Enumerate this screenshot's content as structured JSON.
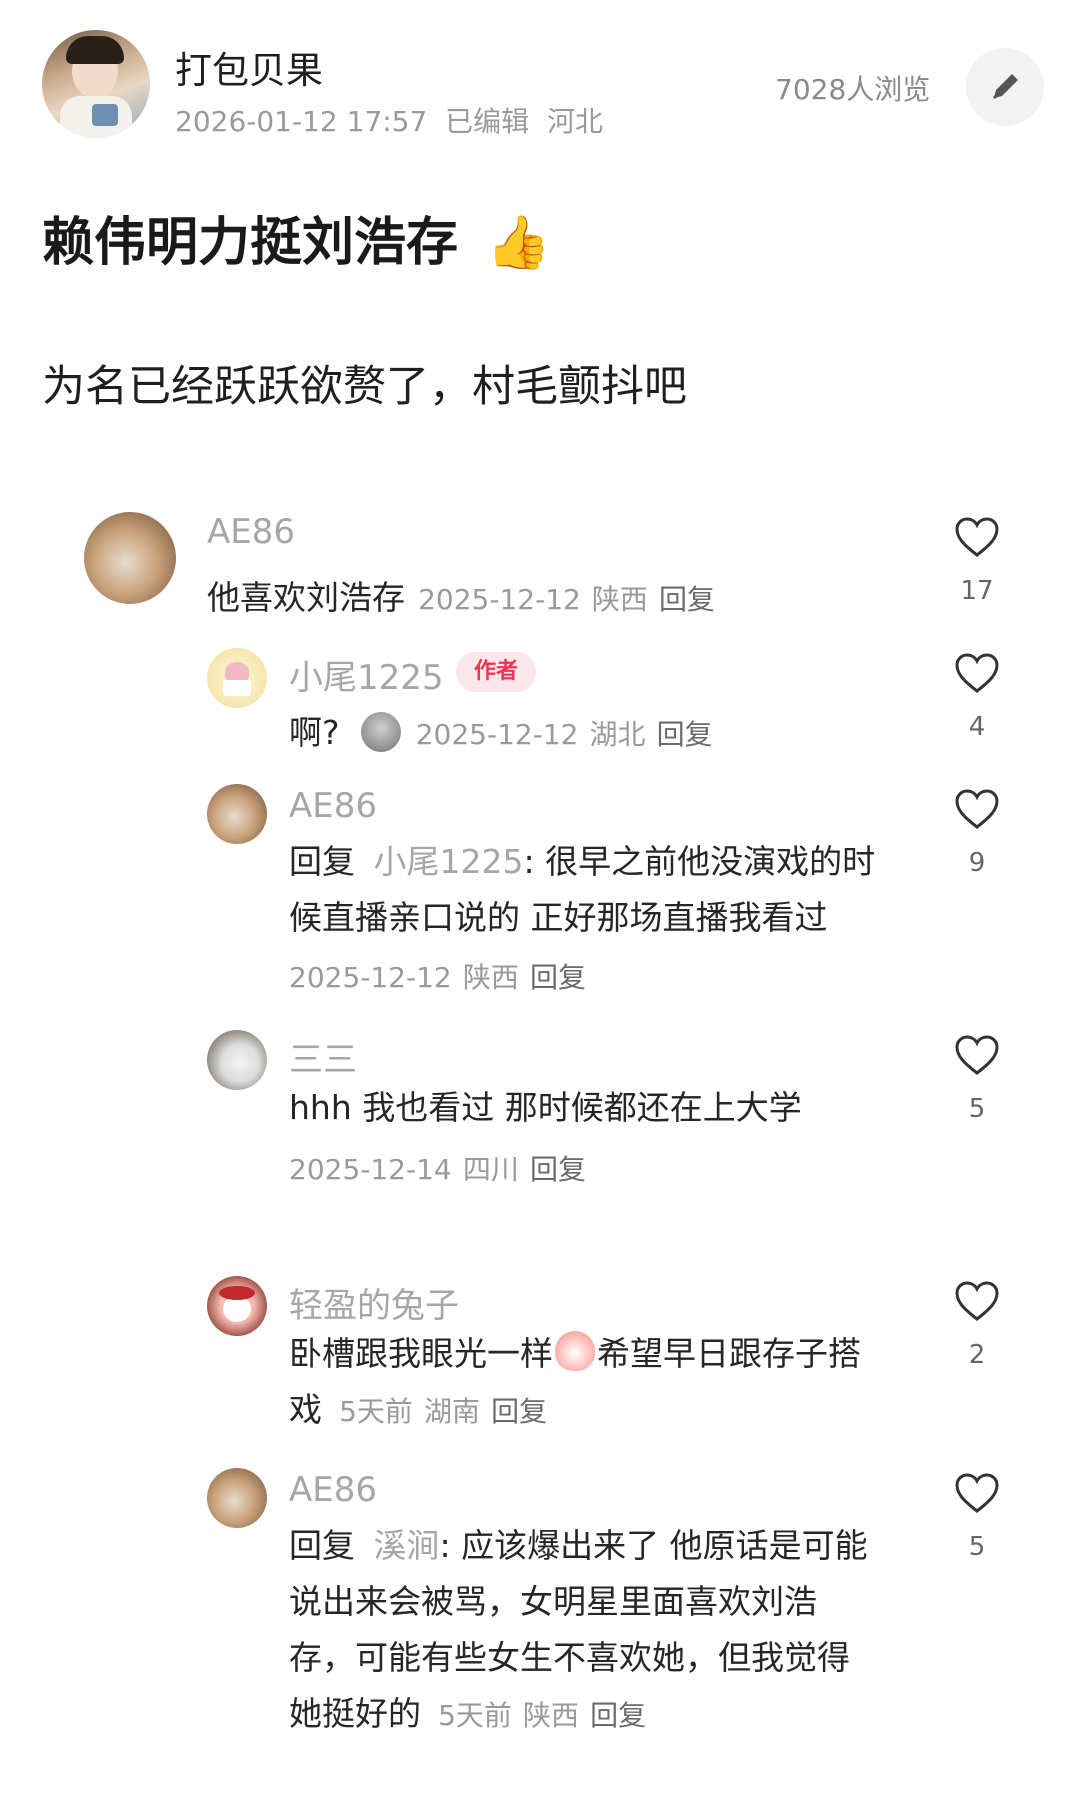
{
  "author": {
    "name": "打包贝果",
    "datetime": "2026-01-12 17:57",
    "edited": "已编辑",
    "location": "河北",
    "views": "7028人浏览"
  },
  "post": {
    "title": "赖伟明力挺刘浩存",
    "title_emoji": "👍",
    "content": "为名已经跃跃欲赘了，村毛颤抖吧"
  },
  "comments": [
    {
      "user": "AE86",
      "text": "他喜欢刘浩存",
      "date": "2025-12-12",
      "location": "陕西",
      "reply": "回复",
      "likes": "17"
    },
    {
      "user": "小尾1225",
      "badge": "作者",
      "text": "啊?",
      "date": "2025-12-12",
      "location": "湖北",
      "reply": "回复",
      "likes": "4"
    },
    {
      "user": "AE86",
      "reply_prefix": "回复",
      "reply_to": "小尾1225",
      "line1": ": 很早之前他没演戏的时",
      "line2": "候直播亲口说的 正好那场直播我看过",
      "date": "2025-12-12",
      "location": "陕西",
      "reply": "回复",
      "likes": "9"
    },
    {
      "user": "三三",
      "text": "hhh 我也看过 那时候都还在上大学",
      "date": "2025-12-14",
      "location": "四川",
      "reply": "回复",
      "likes": "5"
    },
    {
      "user": "轻盈的兔子",
      "line1a": "卧槽跟我眼光一样",
      "line1b": "希望早日跟存子搭",
      "line2": "戏",
      "date": "5天前",
      "location": "湖南",
      "reply": "回复",
      "likes": "2"
    },
    {
      "user": "AE86",
      "reply_prefix": "回复",
      "reply_to": "溪涧",
      "line1": ": 应该爆出来了 他原话是可能",
      "line2": "说出来会被骂，女明星里面喜欢刘浩",
      "line3": "存，可能有些女生不喜欢她，但我觉得",
      "line4": "她挺好的",
      "date": "5天前",
      "location": "陕西",
      "reply": "回复",
      "likes": "5"
    }
  ]
}
